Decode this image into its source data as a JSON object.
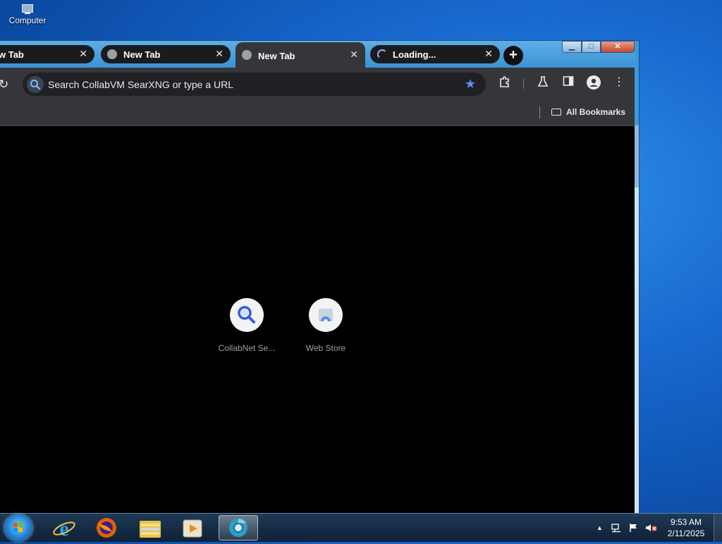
{
  "desktop": {
    "icons": [
      {
        "label": "Computer",
        "icon": "computer-icon"
      }
    ]
  },
  "browser": {
    "tabs": [
      {
        "title": "w Tab",
        "icon": "globe-icon",
        "state": "normal"
      },
      {
        "title": "New Tab",
        "icon": "globe-icon",
        "state": "normal"
      },
      {
        "title": "New Tab",
        "icon": "globe-icon",
        "state": "active"
      },
      {
        "title": "Loading...",
        "icon": "spinner-icon",
        "state": "loading"
      }
    ],
    "tab_close_glyph": "✕",
    "new_tab_glyph": "+",
    "window_controls": {
      "minimize": "▁",
      "maximize": "□",
      "close": "✕"
    },
    "omnibox": {
      "placeholder": "Search CollabVM SearXNG or type a URL"
    },
    "toolbar_icons": [
      "reload-icon",
      "search-icon",
      "star-icon",
      "extensions-icon",
      "labs-icon",
      "side-panel-icon",
      "profile-icon",
      "menu-icon"
    ],
    "bookmarks_bar": {
      "all_bookmarks_label": "All Bookmarks"
    },
    "shortcuts": [
      {
        "label": "CollabNet Se...",
        "icon": "search-icon"
      },
      {
        "label": "Web Store",
        "icon": "web-store-icon"
      }
    ]
  },
  "taskbar": {
    "apps": [
      {
        "name": "Internet Explorer",
        "icon": "internet-explorer-icon"
      },
      {
        "name": "Firefox",
        "icon": "firefox-icon"
      },
      {
        "name": "Windows Explorer",
        "icon": "folder-icon"
      },
      {
        "name": "Windows Media Player",
        "icon": "media-player-icon"
      },
      {
        "name": "Chromium",
        "icon": "chromium-icon",
        "active": true
      }
    ],
    "clock": {
      "time": "9:53 AM",
      "date": "2/11/2025"
    },
    "tray_icons": [
      "show-hidden-icons-arrow",
      "network-icon",
      "action-center-flag-icon",
      "volume-muted-icon"
    ]
  },
  "colors": {
    "accent": "#8ab4f8",
    "star": "#5f8ff6",
    "page_bg": "#000000",
    "toolbar_bg": "#35363a"
  }
}
